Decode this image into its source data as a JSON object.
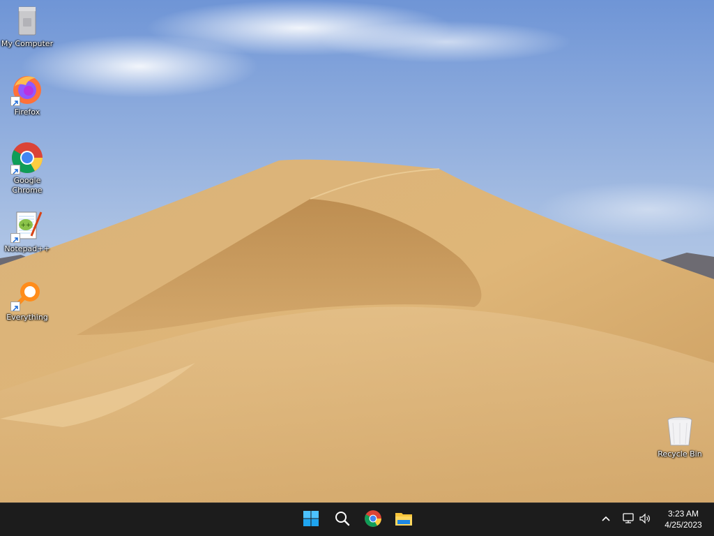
{
  "desktop": {
    "icons": [
      {
        "label": "My Computer",
        "icon": "computer-icon",
        "shortcut": false
      },
      {
        "label": "Firefox",
        "icon": "firefox-icon",
        "shortcut": true
      },
      {
        "label": "Google Chrome",
        "icon": "chrome-icon",
        "shortcut": true
      },
      {
        "label": "Notepad++",
        "icon": "notepad-plus-plus-icon",
        "shortcut": true
      },
      {
        "label": "Everything",
        "icon": "everything-search-icon",
        "shortcut": true
      },
      {
        "label": "Recycle Bin",
        "icon": "recycle-bin-icon",
        "shortcut": false
      }
    ]
  },
  "taskbar": {
    "pinned": [
      {
        "name": "Start",
        "icon": "windows-start-icon"
      },
      {
        "name": "Search",
        "icon": "search-icon"
      },
      {
        "name": "Google Chrome",
        "icon": "chrome-icon"
      },
      {
        "name": "File Explorer",
        "icon": "file-explorer-icon"
      }
    ],
    "tray": {
      "icons": [
        "chevron-up-icon",
        "network-icon",
        "volume-icon"
      ]
    },
    "clock": {
      "time": "3:23 AM",
      "date": "4/25/2023"
    }
  },
  "colors": {
    "taskbar_bg": "#1c1c1c",
    "sky_top": "#7fa1d9",
    "sky_bottom": "#d6e2f0",
    "dune": "#d5aa6e",
    "dune_shadow": "#a87a42"
  }
}
